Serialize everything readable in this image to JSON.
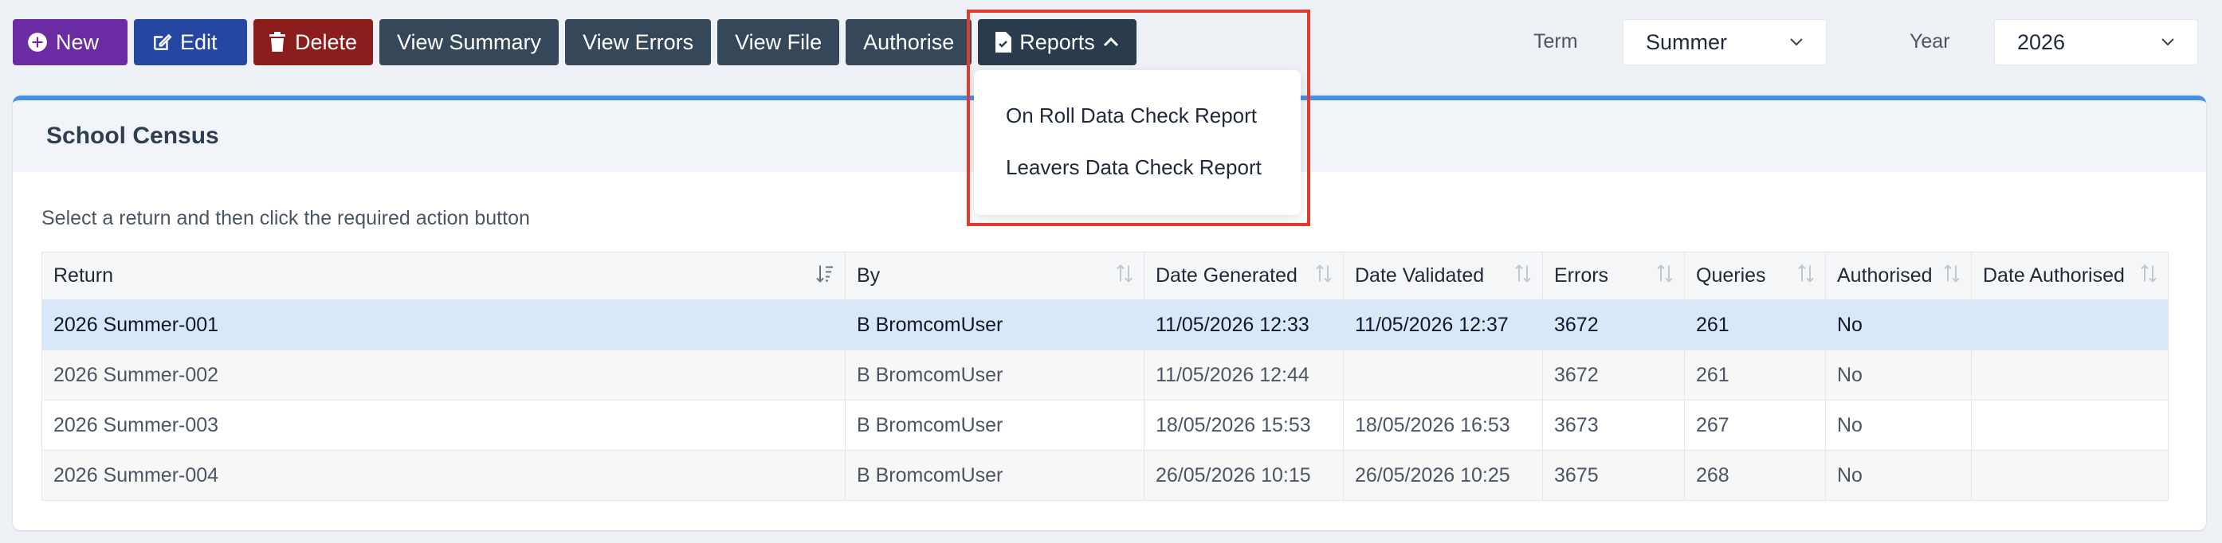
{
  "toolbar": {
    "new_label": "New",
    "edit_label": "Edit",
    "delete_label": "Delete",
    "view_summary_label": "View Summary",
    "view_errors_label": "View Errors",
    "view_file_label": "View File",
    "authorise_label": "Authorise",
    "reports_label": "Reports"
  },
  "filters": {
    "term_label": "Term",
    "term_value": "Summer",
    "year_label": "Year",
    "year_value": "2026"
  },
  "reports_menu": {
    "items": [
      {
        "label": "On Roll Data Check Report"
      },
      {
        "label": "Leavers Data Check Report"
      }
    ]
  },
  "card": {
    "title": "School Census",
    "instructions": "Select a return and then click the required action button"
  },
  "table": {
    "columns": [
      "Return",
      "By",
      "Date Generated",
      "Date Validated",
      "Errors",
      "Queries",
      "Authorised",
      "Date Authorised"
    ],
    "rows": [
      {
        "return": "2026 Summer-001",
        "by": "B BromcomUser",
        "date_generated": "11/05/2026 12:33",
        "date_validated": "11/05/2026 12:37",
        "errors": "3672",
        "queries": "261",
        "authorised": "No",
        "date_authorised": ""
      },
      {
        "return": "2026 Summer-002",
        "by": "B BromcomUser",
        "date_generated": "11/05/2026 12:44",
        "date_validated": "",
        "errors": "3672",
        "queries": "261",
        "authorised": "No",
        "date_authorised": ""
      },
      {
        "return": "2026 Summer-003",
        "by": "B BromcomUser",
        "date_generated": "18/05/2026 15:53",
        "date_validated": "18/05/2026 16:53",
        "errors": "3673",
        "queries": "267",
        "authorised": "No",
        "date_authorised": ""
      },
      {
        "return": "2026 Summer-004",
        "by": "B BromcomUser",
        "date_generated": "26/05/2026 10:15",
        "date_validated": "26/05/2026 10:25",
        "errors": "3675",
        "queries": "268",
        "authorised": "No",
        "date_authorised": ""
      }
    ]
  },
  "colors": {
    "new": "#6b2ba3",
    "edit": "#2546a3",
    "delete": "#8c1d1d",
    "toolbar_dark": "#37475a",
    "card_accent": "#4a90e2",
    "selected_row": "#d9e7fb",
    "highlight_box": "#e23b2e"
  },
  "icons": {
    "new": "plus-circle-icon",
    "edit": "edit-icon",
    "delete": "trash-icon",
    "reports": "document-check-icon",
    "reports_toggle": "chevron-up-icon",
    "select_toggle": "chevron-down-icon",
    "sort": "sort-icon"
  }
}
